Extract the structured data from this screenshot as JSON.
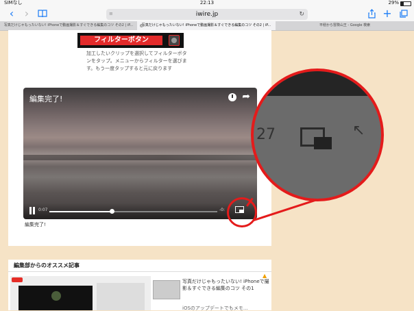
{
  "status": {
    "carrier": "SIMなし",
    "time": "22:13",
    "battery": "29%",
    "battery_level": 0.29
  },
  "toolbar": {
    "back_icon": "chevron-left-icon",
    "forward_icon": "chevron-right-icon",
    "bookmarks_icon": "book-icon",
    "url": "iwire.jp",
    "share_icon": "share-icon",
    "newtab_icon": "plus-icon",
    "tabs_icon": "tabs-icon"
  },
  "tabs": [
    {
      "label": "写真だけじゃもったいない! iPhoneで動画撮影＆すぐできる編集のコツ その2 | iP..."
    },
    {
      "label": "写真だけじゃもったいない! iPhoneで動画撮影＆すぐできる編集のコツ その2 | iP..."
    },
    {
      "label": "平穏から冒険山王 - Google 検索"
    }
  ],
  "article": {
    "filter_button": "フィルターボタン",
    "caption_top": "加工したいクリップを選択してフィルターボタンをタップ。メニューからフィルターを選びます。もう一度タップすると元に戻ります",
    "caption_bottom": "編集完了!"
  },
  "video": {
    "title": "編集完了!",
    "elapsed": "0:07",
    "remaining": "-0:",
    "progress": 0.37
  },
  "zoom": {
    "number_fragment": "27"
  },
  "recommendations": {
    "header": "編集部からのオススメ記事",
    "item1_title": "写真だけじゃもったいない! iPhoneで撮影＆すぐできる編集のコツ その1",
    "item2_title": "iOSのアップデートでもメモ..."
  }
}
